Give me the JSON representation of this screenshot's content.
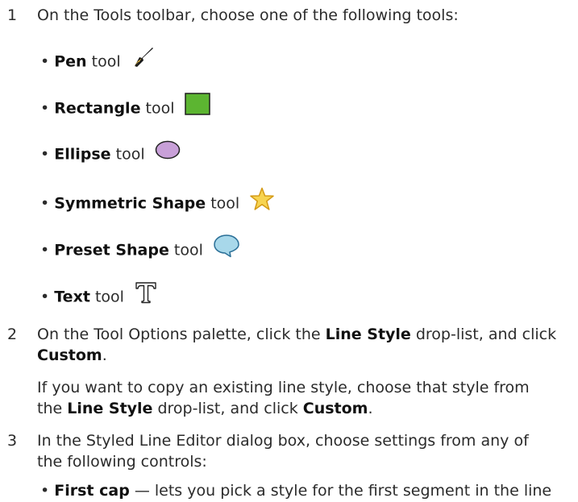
{
  "steps": [
    {
      "number": "1",
      "text": "On the Tools toolbar, choose one of the following tools:"
    },
    {
      "number": "2",
      "line1_pre": "On the Tool Options palette, click the ",
      "line1_bold": "Line Style",
      "line1_post": " drop-list, and click",
      "line2_bold": "Custom",
      "line2_post": "."
    },
    {
      "number": "3",
      "line1": "In the Styled Line Editor dialog box, choose settings from any of",
      "line2": "the following controls:"
    }
  ],
  "tools": [
    {
      "name": "Pen",
      "suffix": " tool",
      "icon": "pen-icon"
    },
    {
      "name": "Rectangle",
      "suffix": " tool",
      "icon": "rectangle-icon",
      "color": "#5cb531"
    },
    {
      "name": "Ellipse",
      "suffix": " tool",
      "icon": "ellipse-icon",
      "color": "#c8a0d8"
    },
    {
      "name": "Symmetric Shape",
      "suffix": " tool",
      "icon": "star-icon",
      "color": "#f7d451"
    },
    {
      "name": "Preset Shape",
      "suffix": " tool",
      "icon": "speech-bubble-icon",
      "color": "#a8d8ea"
    },
    {
      "name": "Text",
      "suffix": " tool",
      "icon": "text-t-icon"
    }
  ],
  "note": {
    "line1": "If you want to copy an existing line style, choose that style from",
    "line2_pre": "the ",
    "line2_bold": "Line Style",
    "line2_mid": " drop-list, and click ",
    "line2_bold2": "Custom",
    "line2_post": "."
  },
  "controls": [
    {
      "name": "First cap",
      "desc": " — lets you pick a style for the first segment in the line"
    }
  ]
}
